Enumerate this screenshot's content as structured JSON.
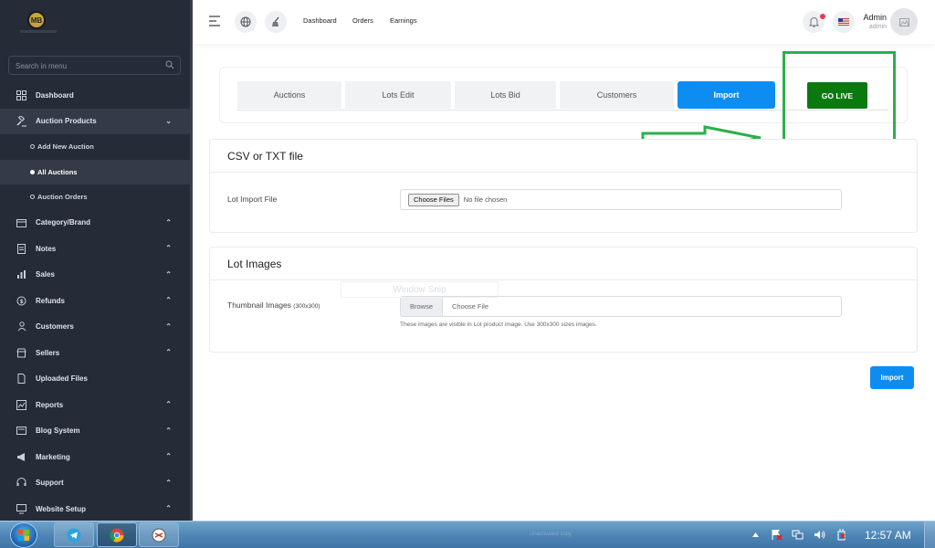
{
  "sidebar": {
    "logo_text": "MB",
    "search_placeholder": "Search in menu",
    "items": [
      {
        "label": "Dashboard",
        "icon": "dashboard-icon"
      },
      {
        "label": "Auction Products",
        "icon": "gavel-icon",
        "expanded": true
      },
      {
        "label": "Category/Brand",
        "icon": "box-icon"
      },
      {
        "label": "Notes",
        "icon": "notes-icon"
      },
      {
        "label": "Sales",
        "icon": "sales-icon"
      },
      {
        "label": "Refunds",
        "icon": "refund-icon"
      },
      {
        "label": "Customers",
        "icon": "users-icon"
      },
      {
        "label": "Sellers",
        "icon": "store-icon"
      },
      {
        "label": "Uploaded Files",
        "icon": "file-icon"
      },
      {
        "label": "Reports",
        "icon": "report-icon"
      },
      {
        "label": "Blog System",
        "icon": "blog-icon"
      },
      {
        "label": "Marketing",
        "icon": "megaphone-icon"
      },
      {
        "label": "Support",
        "icon": "support-icon"
      },
      {
        "label": "Website Setup",
        "icon": "desktop-icon"
      }
    ],
    "subitems": [
      {
        "label": "Add New Auction"
      },
      {
        "label": "All Auctions",
        "selected": true
      },
      {
        "label": "Auction Orders"
      }
    ]
  },
  "header": {
    "links": [
      "Dashboard",
      "Orders",
      "Earnings"
    ],
    "admin_name": "Admin",
    "admin_role": "admin"
  },
  "tabs": [
    "Auctions",
    "Lots Edit",
    "Lots Bid",
    "Customers",
    "Import"
  ],
  "active_tab": "Import",
  "go_live_label": "GO LIVE",
  "csv_panel": {
    "title": "CSV or TXT file",
    "field_label": "Lot Import File",
    "button_label": "Choose Files",
    "status_text": "No file chosen"
  },
  "images_panel": {
    "title": "Lot Images",
    "field_label": "Thumbnail Images",
    "field_hint": "(300x300)",
    "browse_label": "Browse",
    "choose_placeholder": "Choose File",
    "help_text": "These images are visible in Lot product image. Use 300x300 sizes images."
  },
  "ghost_overlay": "Window Snip",
  "import_button": "Import",
  "taskbar": {
    "clock": "12:57 AM",
    "faint_text": "Unactivated copy"
  },
  "colors": {
    "sidebar_bg": "#262b38",
    "primary": "#0d8df2",
    "go_live": "#0a7a10",
    "annotation": "#2bb04a"
  }
}
